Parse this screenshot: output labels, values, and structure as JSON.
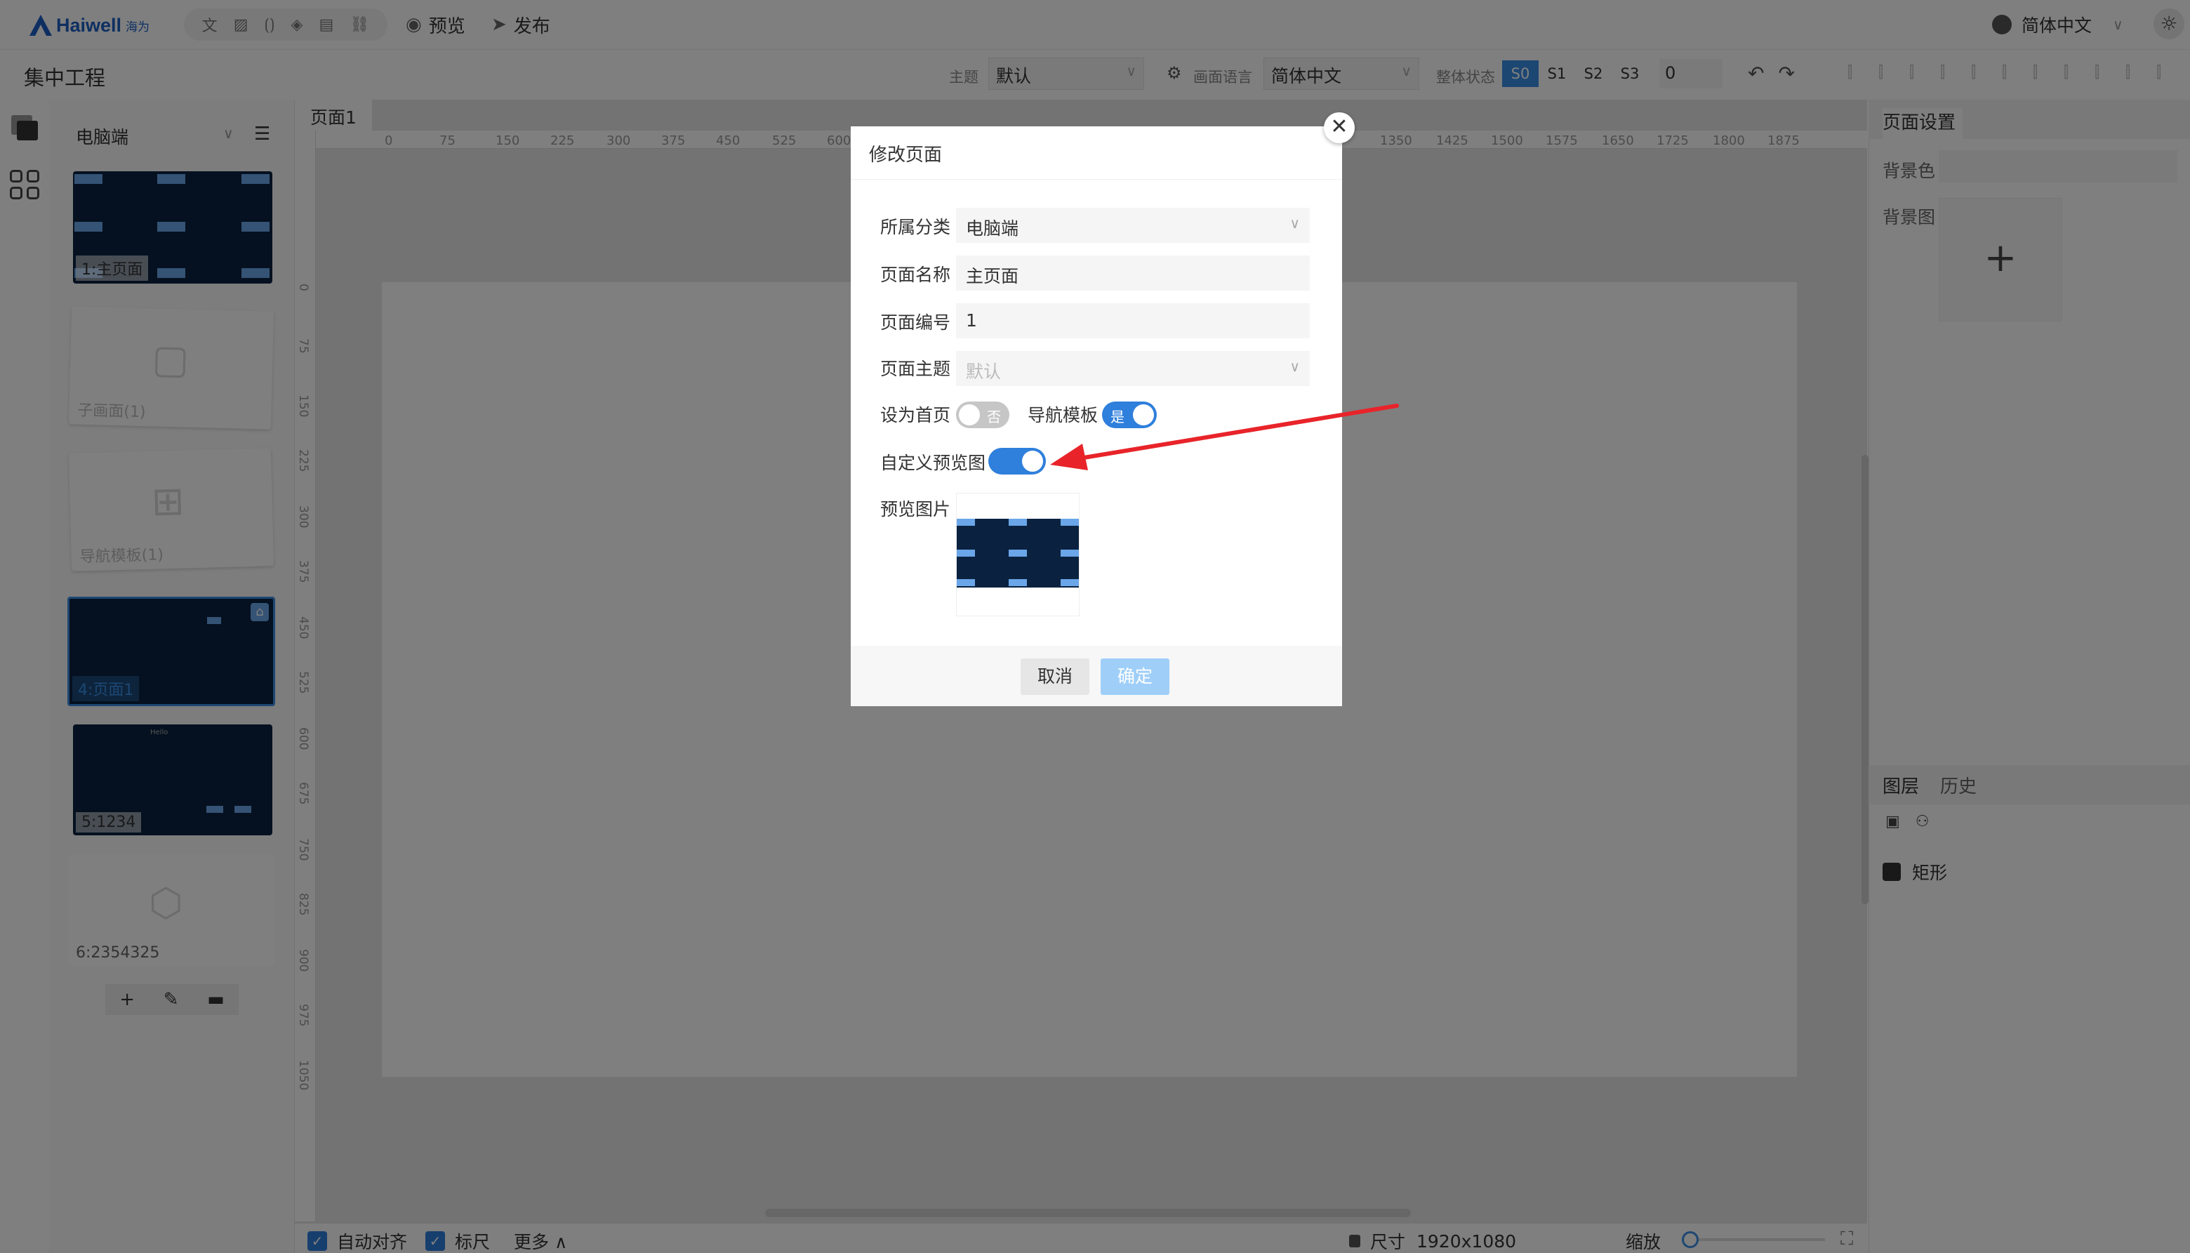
{
  "app": {
    "brand": "Haiwell",
    "brand_sub": "海为",
    "project_title": "集中工程"
  },
  "toolbar": {
    "quick_tools": [
      "文",
      "▨",
      "⟮⟯",
      "◈",
      "▤",
      "⛓"
    ],
    "preview_label": "预览",
    "publish_label": "发布",
    "language": "简体中文"
  },
  "subbar": {
    "theme_label": "主题",
    "theme_value": "默认",
    "screen_lang_label": "画面语言",
    "screen_lang_value": "简体中文",
    "overall_state_label": "整体状态",
    "states": [
      "S0",
      "S1",
      "S2",
      "S3"
    ],
    "state_value": "0"
  },
  "page_panel": {
    "category": "电脑端",
    "pages": [
      {
        "caption": "1:主页面"
      },
      {
        "caption": "子画面(1)"
      },
      {
        "caption": "导航模板(1)"
      },
      {
        "caption": "4:页面1"
      },
      {
        "caption": "5:1234"
      },
      {
        "caption": "6:2354325"
      }
    ],
    "thumb_small_text": "Hello"
  },
  "canvas": {
    "tab": "页面1",
    "ruler_top": [
      "0",
      "75",
      "150",
      "225",
      "300",
      "375",
      "450",
      "525",
      "600",
      "1350",
      "1425",
      "1500",
      "1575",
      "1650",
      "1725",
      "1800",
      "1875"
    ],
    "ruler_left": [
      "0",
      "75",
      "150",
      "225",
      "300",
      "375",
      "450",
      "525",
      "600",
      "675",
      "750",
      "825",
      "900",
      "975",
      "1050"
    ]
  },
  "bottom": {
    "auto_align": "自动对齐",
    "ruler": "标尺",
    "more": "更多",
    "size_label": "尺寸",
    "size_value": "1920x1080",
    "zoom_label": "缩放"
  },
  "right_panel": {
    "title": "页面设置",
    "bg_color_label": "背景色",
    "bg_image_label": "背景图",
    "layers_tab": "图层",
    "history_tab": "历史",
    "layer_item": "矩形"
  },
  "modal": {
    "title": "修改页面",
    "category_label": "所属分类",
    "category_value": "电脑端",
    "name_label": "页面名称",
    "name_value": "主页面",
    "number_label": "页面编号",
    "number_value": "1",
    "theme_label": "页面主题",
    "theme_placeholder": "默认",
    "set_home_label": "设为首页",
    "set_home_text": "否",
    "nav_template_label": "导航模板",
    "nav_template_text": "是",
    "custom_preview_label": "自定义预览图",
    "preview_image_label": "预览图片",
    "cancel": "取消",
    "confirm": "确定"
  },
  "colors": {
    "accent": "#3a8ee6",
    "thumb_dark": "#0a2240",
    "annotation_arrow": "#e8242a"
  }
}
